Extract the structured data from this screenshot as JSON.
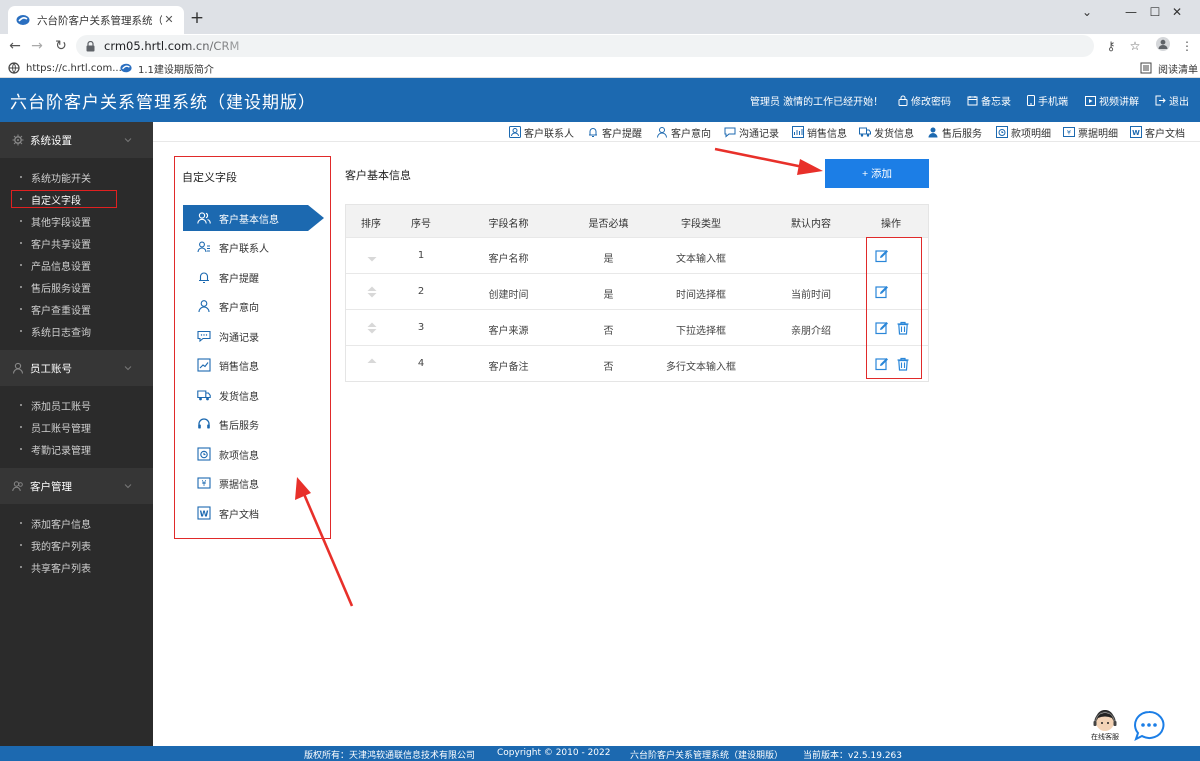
{
  "browser": {
    "tab_title": "六台阶客户关系管理系统（建设期",
    "new_tab": "+",
    "url": "crm05.hrtl.com.cn/CRM",
    "bookmarks": [
      {
        "label": "https://c.hrtl.com...."
      },
      {
        "label": "1.1建设期版简介"
      },
      {
        "label": "阅读清单"
      }
    ]
  },
  "header": {
    "title": "六台阶客户关系管理系统（建设期版）",
    "greeting": "管理员 激情的工作已经开始！",
    "links": [
      {
        "label": "修改密码",
        "icon": "lock-icon"
      },
      {
        "label": "备忘录",
        "icon": "calendar-icon"
      },
      {
        "label": "手机端",
        "icon": "phone-icon"
      },
      {
        "label": "视频讲解",
        "icon": "video-icon"
      },
      {
        "label": "退出",
        "icon": "logout-icon"
      }
    ]
  },
  "sidebar": {
    "groups": [
      {
        "label": "系统设置",
        "icon": "gear-icon",
        "items": [
          "系统功能开关",
          "自定义字段",
          "其他字段设置",
          "客户共享设置",
          "产品信息设置",
          "售后服务设置",
          "客户查重设置",
          "系统日志查询"
        ]
      },
      {
        "label": "员工账号",
        "icon": "user-icon",
        "items": [
          "添加员工账号",
          "员工账号管理",
          "考勤记录管理"
        ]
      },
      {
        "label": "客户管理",
        "icon": "users-icon",
        "items": [
          "添加客户信息",
          "我的客户列表",
          "共享客户列表"
        ]
      }
    ],
    "active_item": "自定义字段"
  },
  "toolbar": {
    "items": [
      "客户联系人",
      "客户提醒",
      "客户意向",
      "沟通记录",
      "销售信息",
      "发货信息",
      "售后服务",
      "款项明细",
      "票据明细",
      "客户文档"
    ]
  },
  "field_panel": {
    "title": "自定义字段",
    "items": [
      "客户基本信息",
      "客户联系人",
      "客户提醒",
      "客户意向",
      "沟通记录",
      "销售信息",
      "发货信息",
      "售后服务",
      "款项信息",
      "票据信息",
      "客户文档"
    ]
  },
  "main": {
    "section_title": "客户基本信息",
    "add_button": "+ 添加",
    "columns": [
      "排序",
      "序号",
      "字段名称",
      "是否必填",
      "字段类型",
      "默认内容",
      "操作"
    ],
    "rows": [
      {
        "index": "1",
        "name": "客户名称",
        "required": "是",
        "type": "文本输入框",
        "default": "",
        "can_delete": false
      },
      {
        "index": "2",
        "name": "创建时间",
        "required": "是",
        "type": "时间选择框",
        "default": "当前时间",
        "can_delete": false
      },
      {
        "index": "3",
        "name": "客户来源",
        "required": "否",
        "type": "下拉选择框",
        "default": "亲朋介绍",
        "can_delete": true
      },
      {
        "index": "4",
        "name": "客户备注",
        "required": "否",
        "type": "多行文本输入框",
        "default": "",
        "can_delete": true
      }
    ]
  },
  "floating": {
    "service_label": "在线客服"
  },
  "footer": {
    "owner": "版权所有：天津鸿软通联信息技术有限公司",
    "copyright": "Copyright © 2010 - 2022",
    "product": "六台阶客户关系管理系统（建设期版）",
    "version": "当前版本：v2.5.19.263"
  },
  "colors": {
    "primary": "#1c69b0",
    "button": "#1c7ee6",
    "highlight": "#e02a2a",
    "sidebar_bg": "#2b2b2b"
  }
}
